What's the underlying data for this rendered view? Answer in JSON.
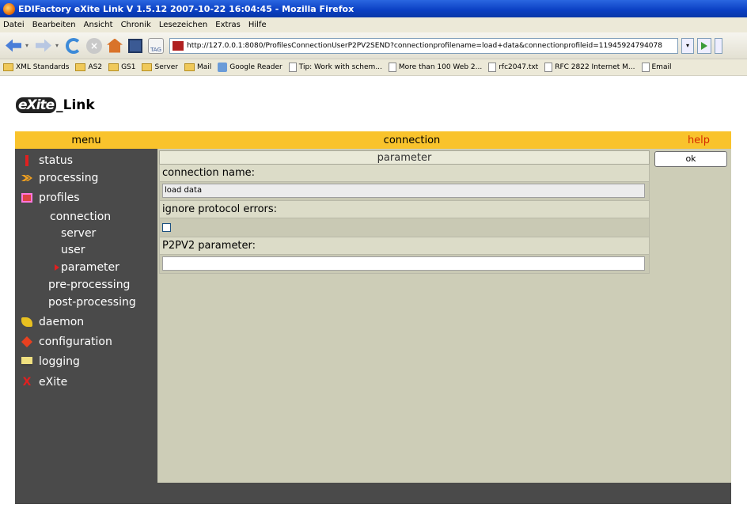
{
  "window": {
    "title": "EDIFactory eXite Link V 1.5.12 2007-10-22 16:04:45 - Mozilla Firefox"
  },
  "menubar": [
    "Datei",
    "Bearbeiten",
    "Ansicht",
    "Chronik",
    "Lesezeichen",
    "Extras",
    "Hilfe"
  ],
  "toolbar": {
    "url": "http://127.0.0.1:8080/ProfilesConnectionUserP2PV2SEND?connectionprofilename=load+data&connectionprofileid=11945924794078",
    "tag_label": "TAG"
  },
  "bookmarks": [
    {
      "label": "XML Standards",
      "type": "folder"
    },
    {
      "label": "AS2",
      "type": "folder"
    },
    {
      "label": "GS1",
      "type": "folder"
    },
    {
      "label": "Server",
      "type": "folder"
    },
    {
      "label": "Mail",
      "type": "folder"
    },
    {
      "label": "Google Reader",
      "type": "feed"
    },
    {
      "label": "Tip: Work with schem...",
      "type": "page"
    },
    {
      "label": "More than 100 Web 2...",
      "type": "page"
    },
    {
      "label": "rfc2047.txt",
      "type": "page"
    },
    {
      "label": "RFC 2822 Internet M...",
      "type": "page"
    },
    {
      "label": "Email",
      "type": "page"
    }
  ],
  "app": {
    "logo_prefix": "eXite",
    "logo_suffix": "_Link",
    "header": {
      "menu": "menu",
      "center": "connection",
      "help": "help"
    },
    "sidebar": {
      "status": "status",
      "processing": "processing",
      "profiles": "profiles",
      "connection": "connection",
      "server": "server",
      "user": "user",
      "parameter": "parameter",
      "pre_processing": "pre-processing",
      "post_processing": "post-processing",
      "daemon": "daemon",
      "configuration": "configuration",
      "logging": "logging",
      "exite": "eXite"
    },
    "form": {
      "heading": "parameter",
      "connection_name_label": "connection name:",
      "connection_name_value": "load data",
      "ignore_errors_label": "ignore protocol errors:",
      "ignore_errors_checked": false,
      "p2pv2_label": "P2PV2 parameter:",
      "p2pv2_value": ""
    },
    "ok_label": "ok"
  }
}
